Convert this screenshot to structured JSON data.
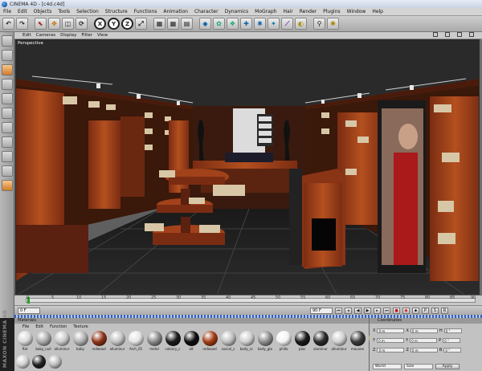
{
  "window": {
    "title": "CINEMA 4D - [c4d.c4d]"
  },
  "menu": [
    "File",
    "Edit",
    "Objects",
    "Tools",
    "Selection",
    "Structure",
    "Functions",
    "Animation",
    "Character",
    "Dynamics",
    "MoGraph",
    "Hair",
    "Render",
    "Plugins",
    "Window",
    "Help"
  ],
  "viewport": {
    "menu": [
      "Edit",
      "Cameras",
      "Display",
      "Filter",
      "View"
    ],
    "label": "Perspective"
  },
  "timeline": {
    "ticks": [
      "0",
      "5",
      "10",
      "15",
      "20",
      "25",
      "30",
      "35",
      "40",
      "45",
      "50",
      "55",
      "60",
      "65",
      "70",
      "75",
      "80",
      "85",
      "90"
    ],
    "start_field": "0 F",
    "end_field": "90 F",
    "current_frame_field": "0 F"
  },
  "materials": {
    "title": "Materials",
    "menu": [
      "File",
      "Edit",
      "Function",
      "Texture"
    ],
    "items": [
      {
        "label": "flat",
        "color": "#d8d8d8"
      },
      {
        "label": "baby_null",
        "color": "#aaaaaa"
      },
      {
        "label": "alluminur",
        "color": "#c9c9c9"
      },
      {
        "label": "baby",
        "color": "#b0b0b0"
      },
      {
        "label": "redwood",
        "color": "#8e3418"
      },
      {
        "label": "alluminur",
        "color": "#c4c4c4"
      },
      {
        "label": "Arch_05",
        "color": "#e3e3e3"
      },
      {
        "label": "metal",
        "color": "#8a8a8a"
      },
      {
        "label": "colonry_c",
        "color": "#1c1c1c"
      },
      {
        "label": "alt",
        "color": "#0d0d0d"
      },
      {
        "label": "redwood",
        "color": "#a23c14"
      },
      {
        "label": "coscol_s",
        "color": "#c0c0c0"
      },
      {
        "label": "body_cc",
        "color": "#d0d0d0"
      },
      {
        "label": "body_gla",
        "color": "#8d8d8d"
      },
      {
        "label": "phillo",
        "color": "#f2f2f2"
      },
      {
        "label": "plas",
        "color": "#1a1a1a"
      },
      {
        "label": "aluminur",
        "color": "#2a2a2a"
      },
      {
        "label": "alluminur",
        "color": "#cfcfcf"
      },
      {
        "label": "mauvee",
        "color": "#3a3a3a"
      },
      {
        "label": "kossula",
        "color": "#b59a4e"
      },
      {
        "label": "spodrue",
        "color": "#e0e0e0"
      }
    ],
    "row2_colors": [
      "#d0d0d0",
      "#222222",
      "#bdbdbd"
    ]
  },
  "coordinates": {
    "title": "Coordinates",
    "rows": [
      {
        "a": "X",
        "v1": "0 m",
        "b": "X",
        "v2": "0 m",
        "c": "H",
        "v3": "0 °"
      },
      {
        "a": "Y",
        "v1": "0 m",
        "b": "Y",
        "v2": "0 m",
        "c": "P",
        "v3": "0 °"
      },
      {
        "a": "Z",
        "v1": "0 m",
        "b": "Z",
        "v2": "0 m",
        "c": "B",
        "v3": "0 °"
      }
    ],
    "mode": "World",
    "size_mode": "Size",
    "apply_label": "Apply"
  },
  "brand": {
    "text": "MAXON CINEMA 4D"
  },
  "toolbar_icons": [
    "undo-icon",
    "redo-icon",
    "move-icon",
    "scale-icon",
    "rotate-icon",
    "x-axis-icon",
    "y-axis-icon",
    "z-axis-icon",
    "world-coords-icon",
    "render-view-icon",
    "render-picture-icon",
    "render-settings-icon",
    "cube-icon",
    "nurbs-icon",
    "array-icon",
    "deformer-icon",
    "scene-icon",
    "light-icon",
    "camera-icon",
    "tag-icon"
  ]
}
